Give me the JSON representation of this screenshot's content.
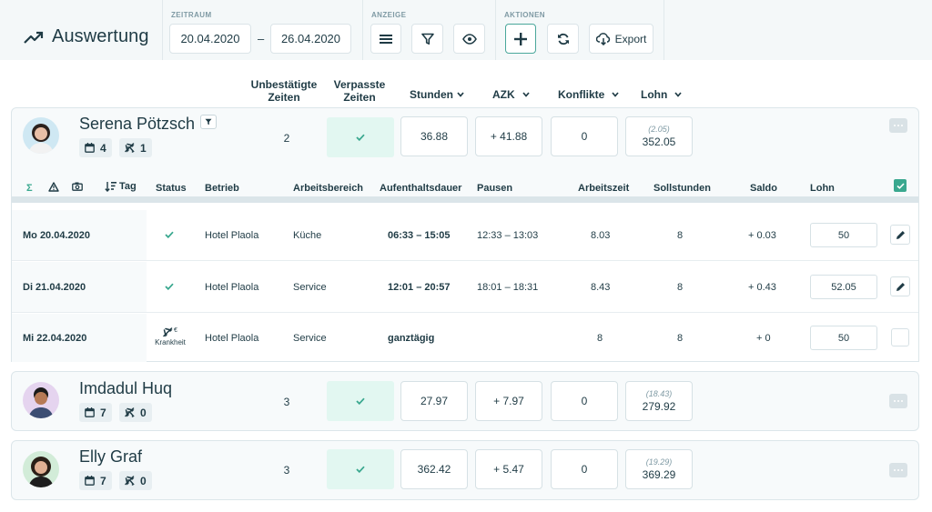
{
  "app": {
    "title": "Auswertung",
    "icon": "trend-up-icon"
  },
  "toolbar": {
    "zeitraum_label": "ZEITRAUM",
    "date_from": "20.04.2020",
    "date_separator": "–",
    "date_to": "26.04.2020",
    "anzeige_label": "ANZEIGE",
    "aktionen_label": "AKTIONEN",
    "export_label": "Export"
  },
  "columns": {
    "unbestaetigt_line1": "Unbestätigte",
    "unbestaetigt_line2": "Zeiten",
    "verpasst_line1": "Verpasste",
    "verpasst_line2": "Zeiten",
    "stunden": "Stunden",
    "azk": "AZK",
    "konflikte": "Konflikte",
    "lohn": "Lohn"
  },
  "employees": [
    {
      "name": "Serena Pötzsch",
      "shifts": "4",
      "absences": "1",
      "unconfirmed": "2",
      "hours": "36.88",
      "azk": "+ 41.88",
      "conflicts": "0",
      "wage_prev": "(2.05)",
      "wage": "352.05"
    },
    {
      "name": "Imdadul Huq",
      "shifts": "7",
      "absences": "0",
      "unconfirmed": "3",
      "hours": "27.97",
      "azk": "+ 7.97",
      "conflicts": "0",
      "wage_prev": "(18.43)",
      "wage": "279.92"
    },
    {
      "name": "Elly Graf",
      "shifts": "7",
      "absences": "0",
      "unconfirmed": "3",
      "hours": "362.42",
      "azk": "+ 5.47",
      "conflicts": "0",
      "wage_prev": "(19.29)",
      "wage": "369.29"
    }
  ],
  "detail": {
    "headers": {
      "sum": "Σ",
      "tag": "Tag",
      "status": "Status",
      "betrieb": "Betrieb",
      "arbeitsbereich": "Arbeitsbereich",
      "aufenthalt": "Aufenthaltsdauer",
      "pausen": "Pausen",
      "arbeitszeit": "Arbeitszeit",
      "sollstunden": "Sollstunden",
      "saldo": "Saldo",
      "lohn": "Lohn"
    },
    "rows": [
      {
        "day": "Mo 20.04.2020",
        "status": "confirmed",
        "betrieb": "Hotel Plaola",
        "bereich": "Küche",
        "aufenthalt": "06:33 – 15:05",
        "pausen": "12:33 – 13:03",
        "arbeitszeit": "8.03",
        "soll": "8",
        "saldo": "+ 0.03",
        "lohn": "50"
      },
      {
        "day": "Di 21.04.2020",
        "status": "confirmed",
        "betrieb": "Hotel Plaola",
        "bereich": "Service",
        "aufenthalt": "12:01 – 20:57",
        "pausen": "18:01 – 18:31",
        "arbeitszeit": "8.43",
        "soll": "8",
        "saldo": "+ 0.43",
        "lohn": "52.05"
      },
      {
        "day": "Mi 22.04.2020",
        "status": "absence",
        "status_label": "Krankheit",
        "status_currency": "€",
        "betrieb": "Hotel Plaola",
        "bereich": "Service",
        "aufenthalt": "ganztägig",
        "pausen": "",
        "arbeitszeit": "8",
        "soll": "8",
        "saldo": "+ 0",
        "lohn": "50"
      }
    ]
  },
  "colors": {
    "accent": "#3aa88f",
    "missed_bg": "#e2f7f1",
    "text": "#1f3b45"
  }
}
